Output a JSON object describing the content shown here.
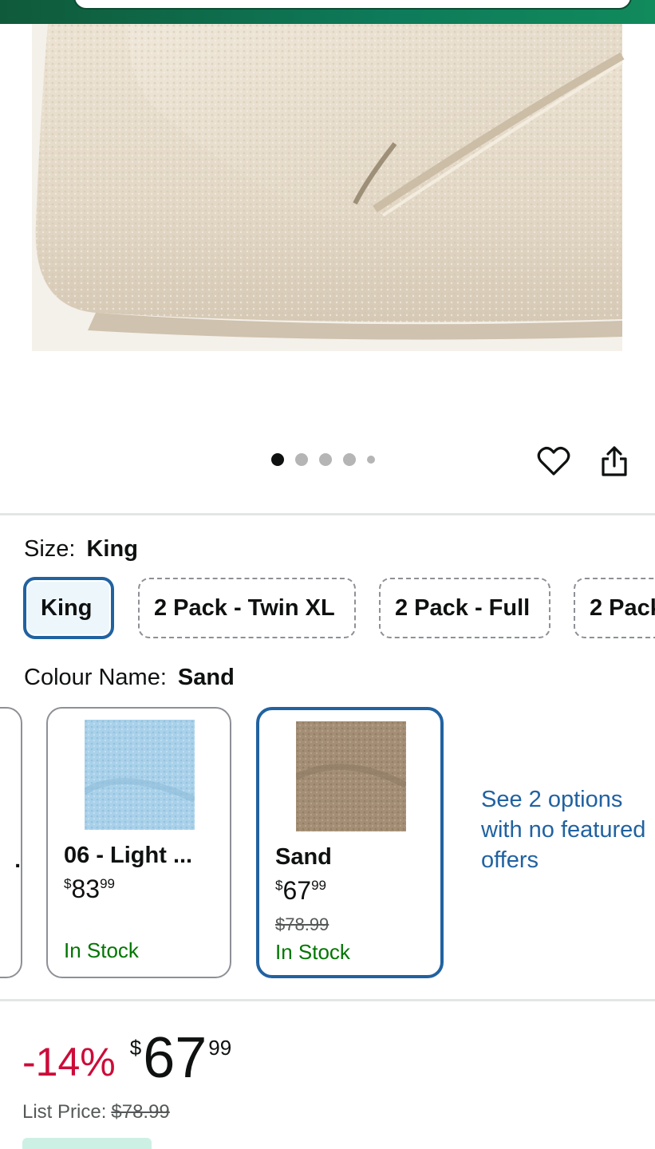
{
  "colors": {
    "header_green": "#0e7b5a",
    "link_blue": "#2162a1",
    "stock_green": "#007600",
    "discount_red": "#cc0c39",
    "sand_swatch": "#a48f76",
    "light_blue_swatch": "#a9d1ea"
  },
  "gallery": {
    "image_count": 5,
    "active_index": 0,
    "icons": [
      "heart-icon",
      "share-icon"
    ]
  },
  "size": {
    "label": "Size:",
    "selected_value": "King",
    "options": [
      "King",
      "2 Pack - Twin XL",
      "2 Pack - Full",
      "2 Pack"
    ]
  },
  "colour": {
    "label": "Colour Name:",
    "selected_value": "Sand",
    "partial_card_text": ".",
    "cards": [
      {
        "name": "06 - Light ...",
        "price_currency": "$",
        "price_whole": "83",
        "price_fraction": "99",
        "stock": "In Stock"
      },
      {
        "name": "Sand",
        "price_currency": "$",
        "price_whole": "67",
        "price_fraction": "99",
        "list_price": "$78.99",
        "stock": "In Stock"
      }
    ],
    "see_options_link": "See 2 options with no featured offers"
  },
  "price": {
    "discount": "-14%",
    "currency": "$",
    "whole": "67",
    "fraction": "99",
    "list_label": "List Price:",
    "list_value": "$78.99"
  }
}
